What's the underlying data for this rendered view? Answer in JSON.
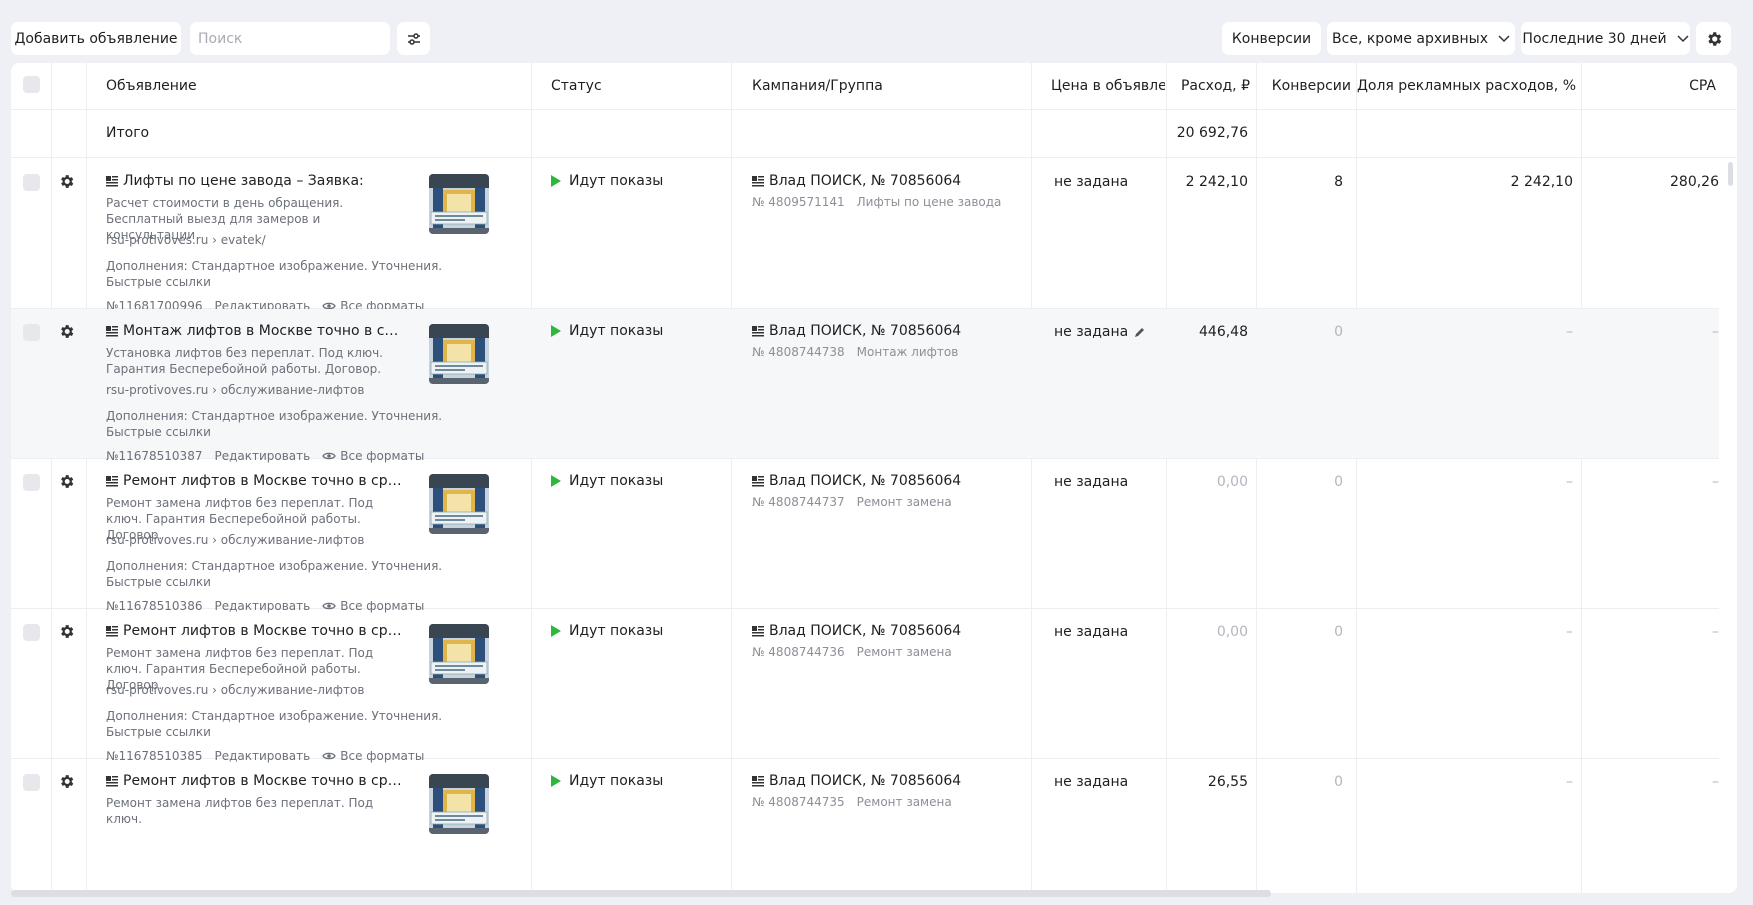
{
  "toolbar": {
    "add_ad_label": "Добавить объявление",
    "search_placeholder": "Поиск",
    "conversions_label": "Конверсии",
    "status_filter_label": "Все, кроме архивных",
    "period_label": "Последние 30 дней"
  },
  "table": {
    "headers": {
      "ad": "Объявление",
      "status": "Статус",
      "campaign": "Кампания/Группа",
      "price": "Цена в объявлен",
      "spend": "Расход, ₽",
      "conversions": "Конверсии",
      "share": "Доля рекламных расходов, %",
      "cpa": "CPA"
    },
    "total": {
      "label": "Итого",
      "spend": "20 692,76"
    },
    "rows": [
      {
        "title": "Лифты по цене завода – Заявка:",
        "desc": "Расчет стоимости в день обращения. Бесплатный выезд для замеров и консультации",
        "url": "rsu-protivoves.ru › evatek/",
        "ext": "Дополнения: Стандартное изображение. Уточнения. Быстрые ссылки",
        "id": "№11681700996",
        "edit": "Редактировать",
        "formats": "Все форматы",
        "status": "Идут показы",
        "campaign": "Влад ПОИСК, № 70856064",
        "group_id": "№ 4809571141",
        "group_name": "Лифты по цене завода",
        "price": "не задана",
        "spend": "2 242,10",
        "conversions": "8",
        "share": "2 242,10",
        "cpa": "280,26"
      },
      {
        "title": "Монтаж лифтов в Москве точно в срок с г...",
        "desc": "Установка лифтов без переплат. Под ключ. Гарантия Бесперебойной работы. Договор.",
        "url": "rsu-protivoves.ru › обслуживание-лифтов",
        "ext": "Дополнения: Стандартное изображение. Уточнения. Быстрые ссылки",
        "id": "№11678510387",
        "edit": "Редактировать",
        "formats": "Все форматы",
        "status": "Идут показы",
        "campaign": "Влад ПОИСК, № 70856064",
        "group_id": "№ 4808744738",
        "group_name": "Монтаж лифтов",
        "price": "не задана",
        "spend": "446,48",
        "conversions": "0",
        "share": "–",
        "cpa": "–"
      },
      {
        "title": "Ремонт лифтов в Москве точно в срок с г...",
        "desc": "Ремонт замена лифтов без переплат. Под ключ. Гарантия Бесперебойной работы. Договор.",
        "url": "rsu-protivoves.ru › обслуживание-лифтов",
        "ext": "Дополнения: Стандартное изображение. Уточнения. Быстрые ссылки",
        "id": "№11678510386",
        "edit": "Редактировать",
        "formats": "Все форматы",
        "status": "Идут показы",
        "campaign": "Влад ПОИСК, № 70856064",
        "group_id": "№ 4808744737",
        "group_name": "Ремонт замена",
        "price": "не задана",
        "spend": "0,00",
        "conversions": "0",
        "share": "–",
        "cpa": "–"
      },
      {
        "title": "Ремонт лифтов в Москве точно в срок с г...",
        "desc": "Ремонт замена лифтов без переплат. Под ключ. Гарантия Бесперебойной работы. Договор.",
        "url": "rsu-protivoves.ru › обслуживание-лифтов",
        "ext": "Дополнения: Стандартное изображение. Уточнения. Быстрые ссылки",
        "id": "№11678510385",
        "edit": "Редактировать",
        "formats": "Все форматы",
        "status": "Идут показы",
        "campaign": "Влад ПОИСК, № 70856064",
        "group_id": "№ 4808744736",
        "group_name": "Ремонт замена",
        "price": "не задана",
        "spend": "0,00",
        "conversions": "0",
        "share": "–",
        "cpa": "–"
      },
      {
        "title": "Ремонт лифтов в Москве точно в срок с г...",
        "desc": "Ремонт замена лифтов без переплат. Под ключ.",
        "url": "",
        "ext": "",
        "id": "",
        "edit": "",
        "formats": "",
        "status": "Идут показы",
        "campaign": "Влад ПОИСК, № 70856064",
        "group_id": "№ 4808744735",
        "group_name": "Ремонт замена",
        "price": "не задана",
        "spend": "26,55",
        "conversions": "0",
        "share": "–",
        "cpa": "–"
      }
    ]
  },
  "colors": {
    "background": "#eef0f5",
    "status_green": "#2db83d",
    "muted_text": "#b3b6bd"
  }
}
